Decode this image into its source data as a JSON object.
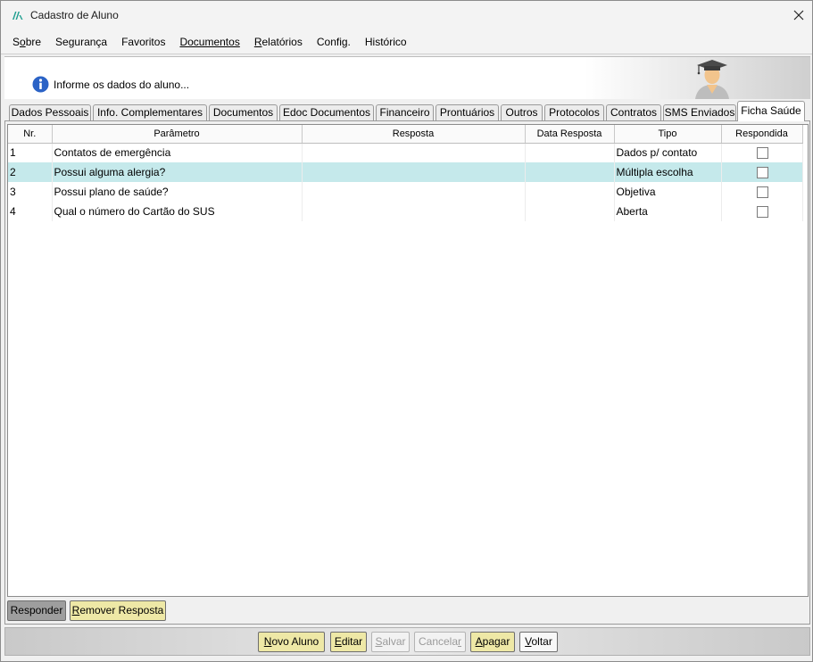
{
  "window": {
    "title": "Cadastro de Aluno"
  },
  "menu": [
    {
      "label": "Sobre",
      "underline": "o"
    },
    {
      "label": "Segurança"
    },
    {
      "label": "Favoritos"
    },
    {
      "label": "Documentos"
    },
    {
      "label": "Relatórios"
    },
    {
      "label": "Config."
    },
    {
      "label": "Histórico"
    }
  ],
  "banner": {
    "info_text": "Informe os dados do aluno..."
  },
  "tabs": [
    "Dados Pessoais",
    "Info. Complementares",
    "Documentos",
    "Edoc Documentos",
    "Financeiro",
    "Prontuários",
    "Outros",
    "Protocolos",
    "Contratos",
    "SMS Enviados",
    "Ficha Saúde"
  ],
  "active_tab": "Ficha Saúde",
  "grid": {
    "columns": [
      "Nr.",
      "Parâmetro",
      "Resposta",
      "Data Resposta",
      "Tipo",
      "Respondida"
    ],
    "rows": [
      {
        "nr": "1",
        "parametro": "Contatos de emergência",
        "resposta": "",
        "data": "",
        "tipo": "Dados p/ contato",
        "respondida": false,
        "selected": false
      },
      {
        "nr": "2",
        "parametro": "Possui alguma alergia?",
        "resposta": "",
        "data": "",
        "tipo": "Múltipla escolha",
        "respondida": false,
        "selected": true
      },
      {
        "nr": "3",
        "parametro": "Possui plano de saúde?",
        "resposta": "",
        "data": "",
        "tipo": "Objetiva",
        "respondida": false,
        "selected": false
      },
      {
        "nr": "4",
        "parametro": "Qual o número do Cartão do SUS",
        "resposta": "",
        "data": "",
        "tipo": "Aberta",
        "respondida": false,
        "selected": false
      }
    ]
  },
  "panel_buttons": {
    "responder": "Responder",
    "remover_prefix": "",
    "remover_u": "R",
    "remover_rest": "emover Resposta"
  },
  "footer_buttons": {
    "novo_u": "N",
    "novo_rest": "ovo Aluno",
    "editar_u": "E",
    "editar_rest": "ditar",
    "salvar_u": "S",
    "salvar_rest": "alvar",
    "cancelar_pre": "Cancela",
    "cancelar_u": "r",
    "apagar_u": "A",
    "apagar_rest": "pagar",
    "voltar_u": "V",
    "voltar_rest": "oltar"
  },
  "colors": {
    "selected_row": "#c5e9eb",
    "button_yellow": "#eee8a6",
    "button_gray": "#9e9e9e",
    "logo_teal": "#1f9e8f"
  },
  "icons": {
    "logo": "app-logo-icon",
    "close": "close-icon",
    "info": "info-icon",
    "avatar": "graduate-avatar-icon"
  }
}
